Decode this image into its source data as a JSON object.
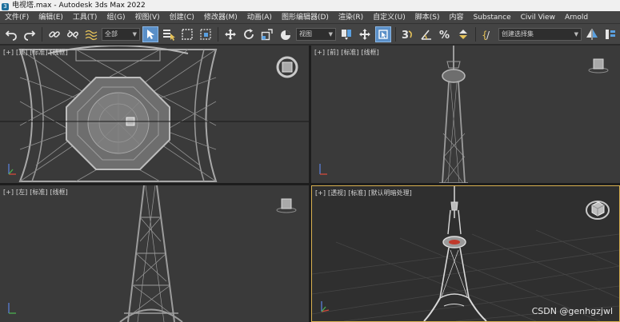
{
  "window": {
    "title": "电视塔.max - Autodesk 3ds Max 2022"
  },
  "menu": [
    "文件(F)",
    "编辑(E)",
    "工具(T)",
    "组(G)",
    "视图(V)",
    "创建(C)",
    "修改器(M)",
    "动画(A)",
    "图形编辑器(D)",
    "渲染(R)",
    "自定义(U)",
    "脚本(S)",
    "内容",
    "Substance",
    "Civil View",
    "Arnold"
  ],
  "toolbar": {
    "selection_filter": "全部",
    "reference_coord": "视图",
    "named_selection": "创建选择集",
    "icons": {
      "undo": "undo-icon",
      "redo": "redo-icon",
      "link": "link-icon",
      "unlink": "unlink-icon",
      "bind_space_warp": "space-warp-icon",
      "select": "select-object-icon",
      "select_by_name": "select-by-name-icon",
      "rect_region": "rectangular-region-icon",
      "window_crossing": "window-crossing-icon",
      "move": "move-icon",
      "rotate": "rotate-icon",
      "scale": "scale-icon",
      "place": "place-icon",
      "pivot": "pivot-icon",
      "manipulate": "manipulate-icon",
      "snap": "snap-3d-icon",
      "angle_snap": "angle-snap-icon",
      "percent_snap": "percent-snap-icon",
      "spinner_snap": "spinner-snap-icon",
      "edit_named_sets": "edit-named-selection-icon",
      "mirror": "mirror-icon",
      "align": "align-icon",
      "layers": "layer-explorer-icon"
    }
  },
  "viewports": {
    "top": {
      "labels": [
        "[+]",
        "[顶]",
        "[标准]",
        "[线框]"
      ]
    },
    "front": {
      "labels": [
        "[+]",
        "[前]",
        "[标准]",
        "[线框]"
      ]
    },
    "left": {
      "labels": [
        "[+]",
        "[左]",
        "[标准]",
        "[线框]"
      ]
    },
    "perspective": {
      "labels": [
        "[+]",
        "[透视]",
        "[标准]",
        "[默认明暗处理]"
      ]
    }
  },
  "colors": {
    "active_viewport_border": "#d8b050",
    "axis_x": "#d24a3a",
    "axis_y": "#4caf50",
    "axis_z": "#5a7fd6",
    "selection_highlight": "#5a8fc8"
  },
  "watermark": "CSDN @genhgzjwl"
}
